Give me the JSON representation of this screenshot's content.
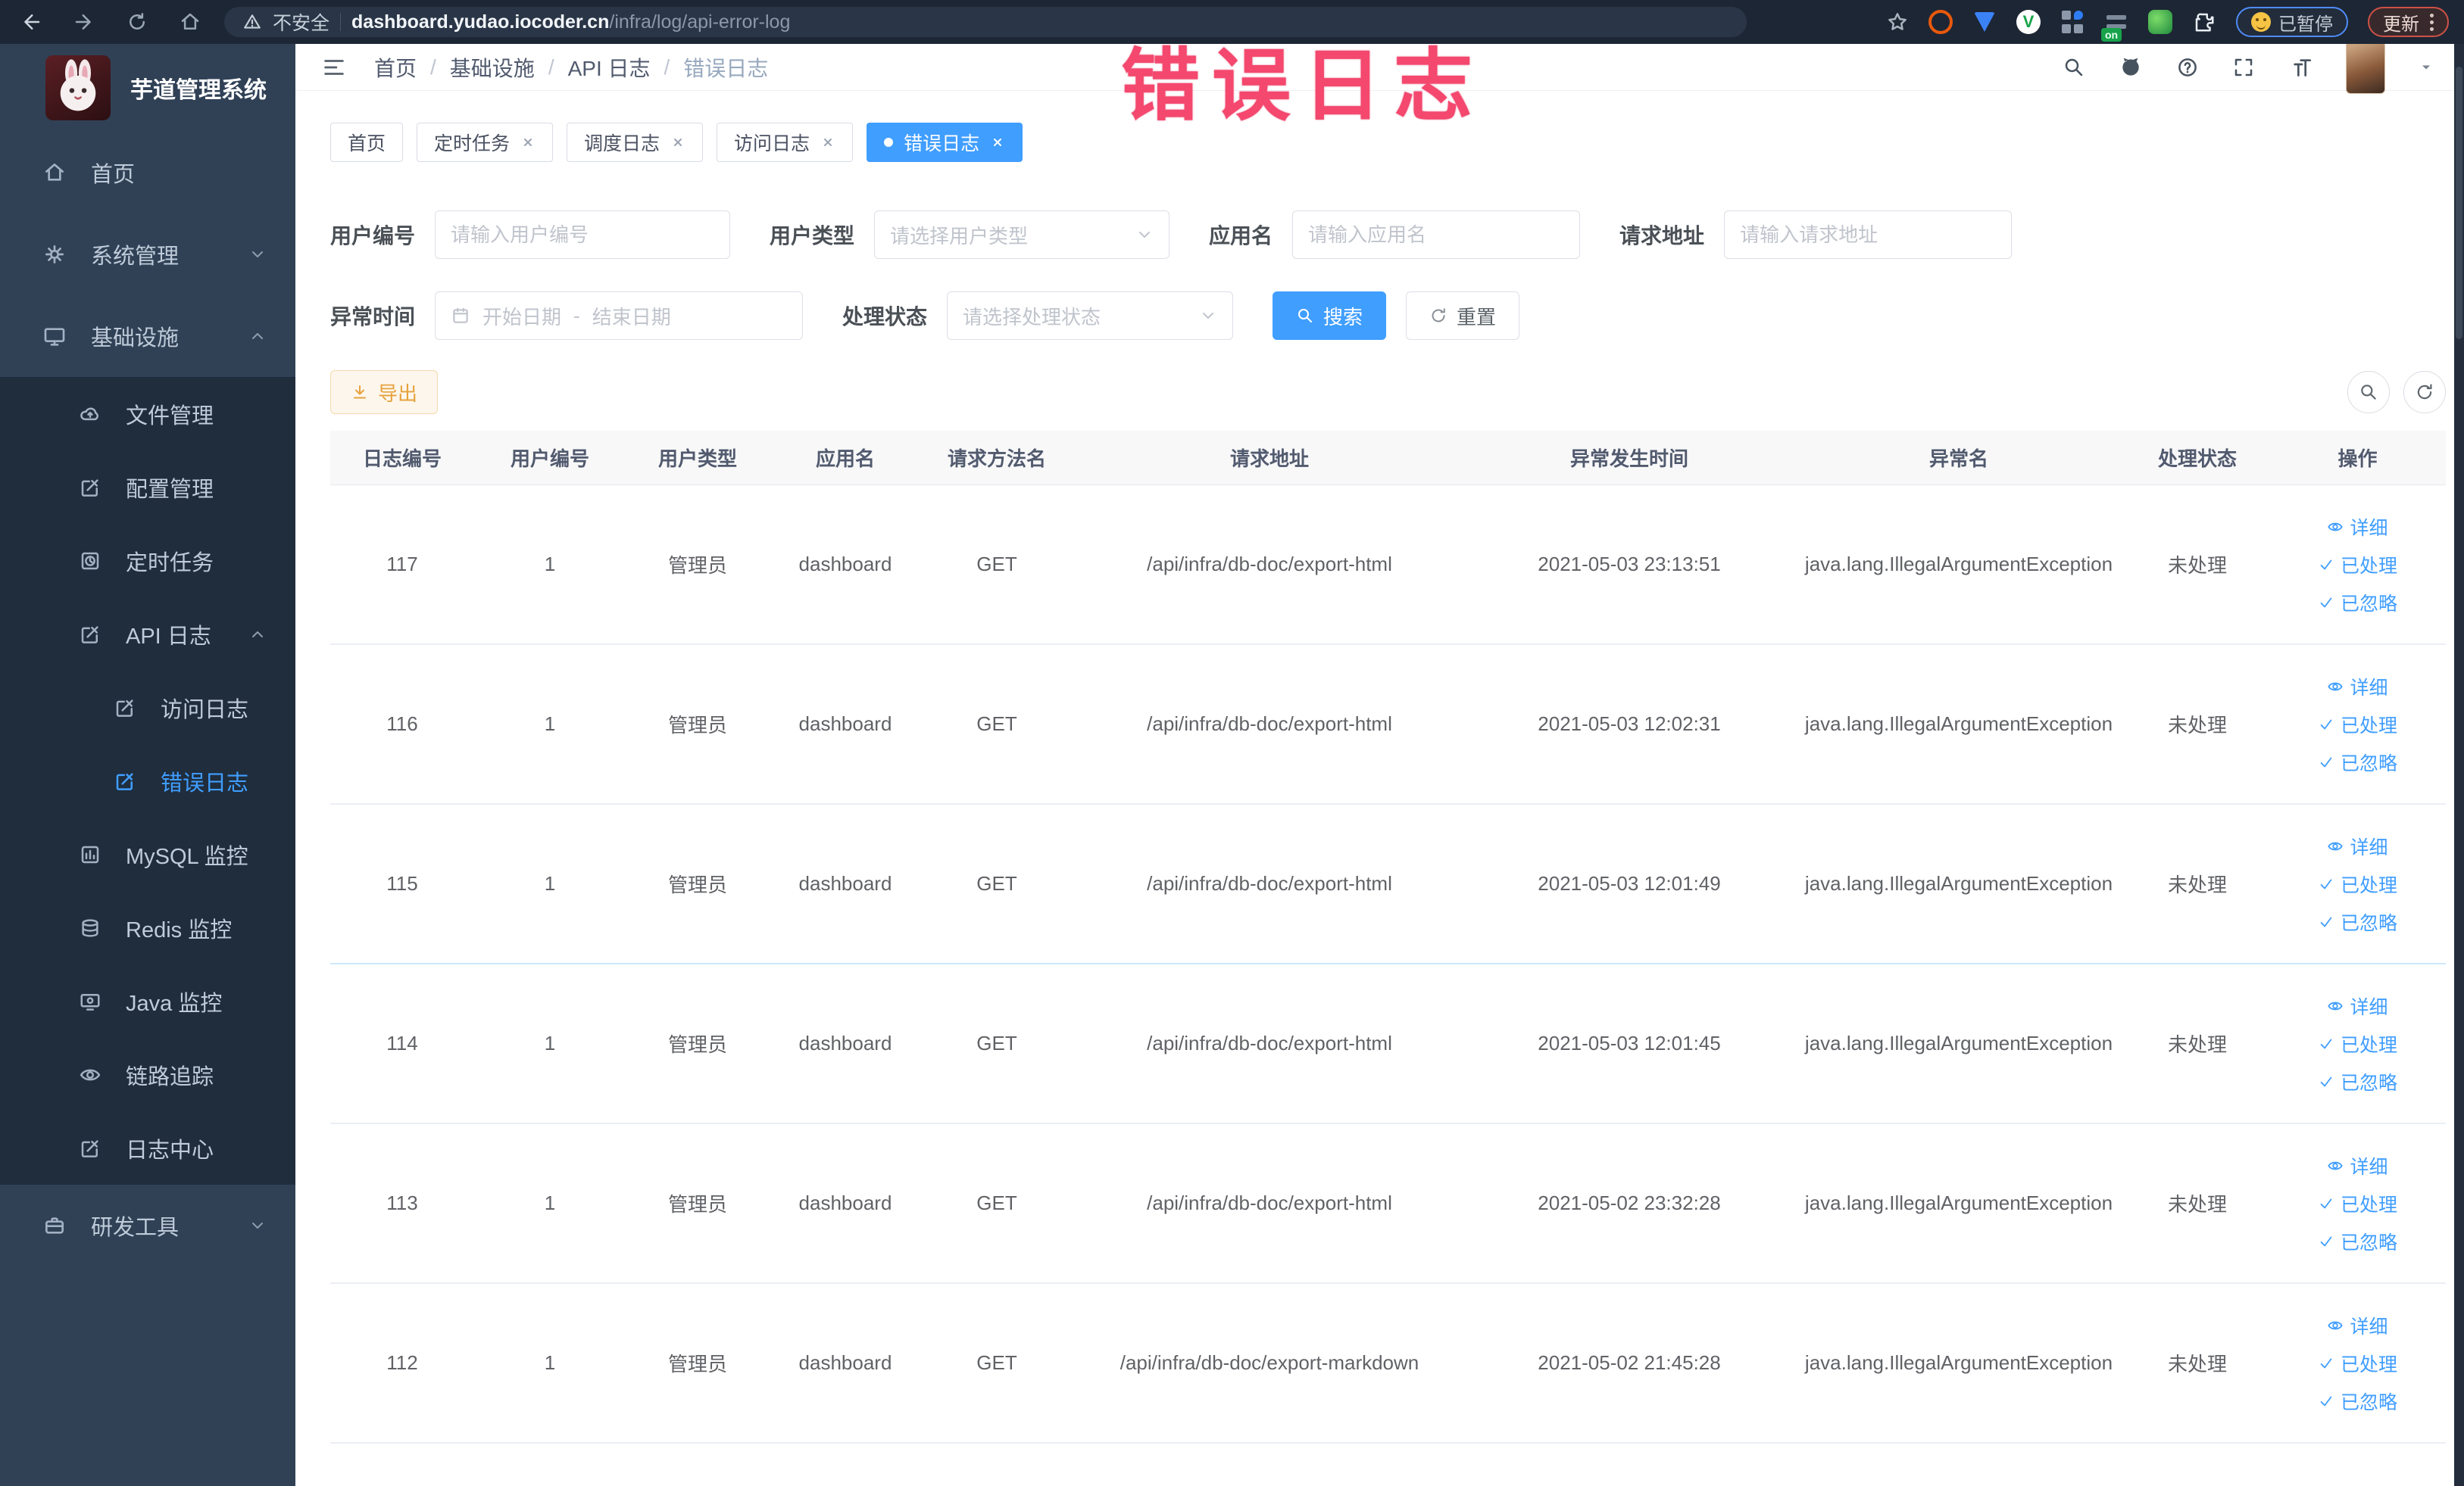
{
  "annotation": "错误日志",
  "browser": {
    "security_label": "不安全",
    "url_domain": "dashboard.yudao.iocoder.cn",
    "url_path": "/infra/log/api-error-log",
    "paused_label": "已暂停",
    "update_label": "更新"
  },
  "sidebar": {
    "title": "芋道管理系统",
    "items": [
      {
        "label": "首页"
      },
      {
        "label": "系统管理"
      },
      {
        "label": "基础设施"
      },
      {
        "label": "文件管理"
      },
      {
        "label": "配置管理"
      },
      {
        "label": "定时任务"
      },
      {
        "label": "API 日志"
      },
      {
        "label": "访问日志"
      },
      {
        "label": "错误日志"
      },
      {
        "label": "MySQL 监控"
      },
      {
        "label": "Redis 监控"
      },
      {
        "label": "Java 监控"
      },
      {
        "label": "链路追踪"
      },
      {
        "label": "日志中心"
      },
      {
        "label": "研发工具"
      }
    ]
  },
  "breadcrumb": {
    "items": [
      "首页",
      "基础设施",
      "API 日志",
      "错误日志"
    ],
    "separator": "/"
  },
  "tabs": [
    {
      "label": "首页"
    },
    {
      "label": "定时任务"
    },
    {
      "label": "调度日志"
    },
    {
      "label": "访问日志"
    },
    {
      "label": "错误日志"
    }
  ],
  "filters": {
    "user_id_label": "用户编号",
    "user_id_placeholder": "请输入用户编号",
    "user_type_label": "用户类型",
    "user_type_placeholder": "请选择用户类型",
    "app_name_label": "应用名",
    "app_name_placeholder": "请输入应用名",
    "request_url_label": "请求地址",
    "request_url_placeholder": "请输入请求地址",
    "exception_time_label": "异常时间",
    "date_start_placeholder": "开始日期",
    "date_separator": "-",
    "date_end_placeholder": "结束日期",
    "process_status_label": "处理状态",
    "process_status_placeholder": "请选择处理状态",
    "search_label": "搜索",
    "reset_label": "重置"
  },
  "toolbar": {
    "export_label": "导出"
  },
  "table": {
    "columns": [
      "日志编号",
      "用户编号",
      "用户类型",
      "应用名",
      "请求方法名",
      "请求地址",
      "异常发生时间",
      "异常名",
      "处理状态",
      "操作"
    ],
    "actions": [
      "详细",
      "已处理",
      "已忽略"
    ],
    "rows": [
      {
        "id": "117",
        "user_id": "1",
        "user_type": "管理员",
        "app": "dashboard",
        "method": "GET",
        "url": "/api/infra/db-doc/export-html",
        "time": "2021-05-03 23:13:51",
        "exception": "java.lang.IllegalArgumentException",
        "status": "未处理"
      },
      {
        "id": "116",
        "user_id": "1",
        "user_type": "管理员",
        "app": "dashboard",
        "method": "GET",
        "url": "/api/infra/db-doc/export-html",
        "time": "2021-05-03 12:02:31",
        "exception": "java.lang.IllegalArgumentException",
        "status": "未处理"
      },
      {
        "id": "115",
        "user_id": "1",
        "user_type": "管理员",
        "app": "dashboard",
        "method": "GET",
        "url": "/api/infra/db-doc/export-html",
        "time": "2021-05-03 12:01:49",
        "exception": "java.lang.IllegalArgumentException",
        "status": "未处理"
      },
      {
        "id": "114",
        "user_id": "1",
        "user_type": "管理员",
        "app": "dashboard",
        "method": "GET",
        "url": "/api/infra/db-doc/export-html",
        "time": "2021-05-03 12:01:45",
        "exception": "java.lang.IllegalArgumentException",
        "status": "未处理"
      },
      {
        "id": "113",
        "user_id": "1",
        "user_type": "管理员",
        "app": "dashboard",
        "method": "GET",
        "url": "/api/infra/db-doc/export-html",
        "time": "2021-05-02 23:32:28",
        "exception": "java.lang.IllegalArgumentException",
        "status": "未处理"
      },
      {
        "id": "112",
        "user_id": "1",
        "user_type": "管理员",
        "app": "dashboard",
        "method": "GET",
        "url": "/api/infra/db-doc/export-markdown",
        "time": "2021-05-02 21:45:28",
        "exception": "java.lang.IllegalArgumentException",
        "status": "未处理"
      }
    ]
  },
  "colors": {
    "accent": "#409eff",
    "warning": "#e6a23c",
    "annotation": "#f4486e",
    "sidebar_bg": "#304156",
    "submenu_bg": "#1f2d3d"
  }
}
